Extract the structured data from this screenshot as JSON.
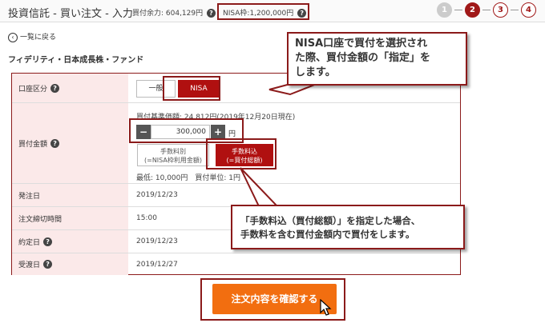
{
  "header": {
    "title": "投資信託 - 買い注文 - 入力",
    "buying_power": "買付余力: 604,129円",
    "nisa_limit": "NISA枠:1,200,000円",
    "steps": [
      "1",
      "2",
      "3",
      "4"
    ]
  },
  "nav": {
    "back_label": "一覧に戻る"
  },
  "fund": {
    "name": "フィデリティ・日本成長株・ファンド"
  },
  "form": {
    "account_type": {
      "label": "口座区分",
      "options": [
        "一般",
        "NISA"
      ],
      "selected": "NISA"
    },
    "amount": {
      "label": "買付金額",
      "base_price": "買付基準価額: 24,812円(2019年12月20日現在)",
      "value": "300,000",
      "unit": "円",
      "minus": "−",
      "plus": "+",
      "fee_excl_line1": "手数料別",
      "fee_excl_line2": "(=NISA枠利用金額)",
      "fee_incl_line1": "手数料込",
      "fee_incl_line2": "(=買付総額)",
      "min_note": "最低: 10,000円　買付単位: 1円"
    },
    "order_date": {
      "label": "発注日",
      "value": "2019/12/23"
    },
    "cutoff": {
      "label": "注文締切時間",
      "value": "15:00"
    },
    "contract_date": {
      "label": "約定日",
      "value": "2019/12/23"
    },
    "settlement_date": {
      "label": "受渡日",
      "value": "2019/12/27"
    }
  },
  "callouts": {
    "first_line1": "NISA口座で買付を選択され",
    "first_line2": "た際、買付金額の「指定」を",
    "first_line3": "します。",
    "second_line1": "「手数料込（買付総額）」を指定した場合、",
    "second_line2": "手数料を含む買付金額内で買付をします。"
  },
  "confirm_label": "注文内容を確認する",
  "colors": {
    "accent": "#b01010",
    "outline": "#8b1a1a",
    "confirm": "#f26e10",
    "label_bg": "#fbe9e9"
  }
}
